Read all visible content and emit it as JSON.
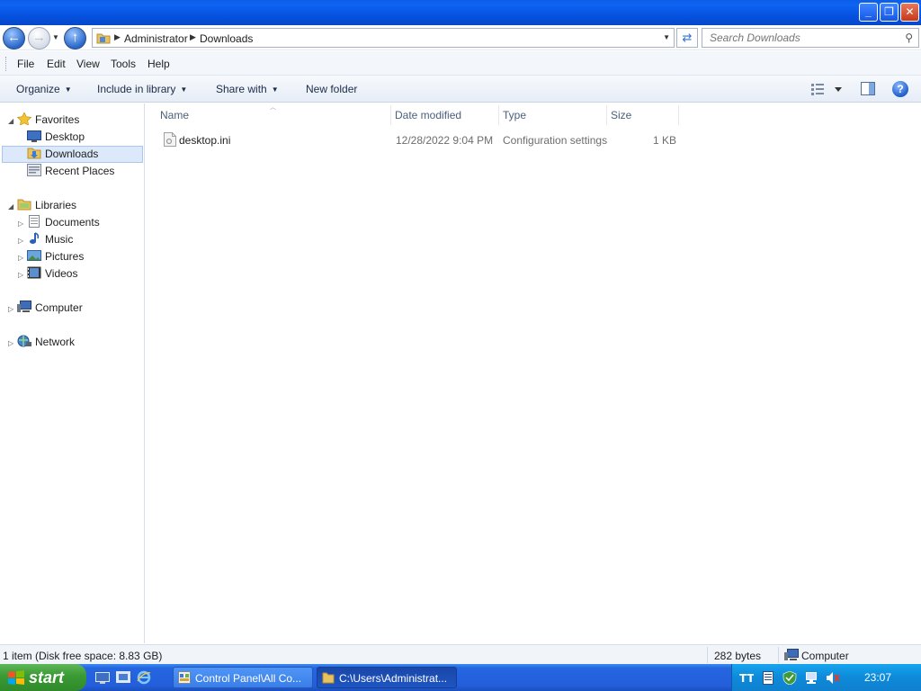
{
  "window": {
    "controls": {
      "minimize": "_",
      "restore": "❐",
      "close": "✕"
    }
  },
  "address": {
    "crumbs": [
      "Administrator",
      "Downloads"
    ],
    "search_placeholder": "Search Downloads"
  },
  "menu": {
    "items": [
      "File",
      "Edit",
      "View",
      "Tools",
      "Help"
    ]
  },
  "commands": {
    "organize": "Organize",
    "include_in_library": "Include in library",
    "share_with": "Share with",
    "new_folder": "New folder",
    "help": "?"
  },
  "nav": {
    "favorites": "Favorites",
    "desktop": "Desktop",
    "downloads": "Downloads",
    "recent_places": "Recent Places",
    "libraries": "Libraries",
    "documents": "Documents",
    "music": "Music",
    "pictures": "Pictures",
    "videos": "Videos",
    "computer": "Computer",
    "network": "Network"
  },
  "columns": {
    "name": "Name",
    "date_modified": "Date modified",
    "type": "Type",
    "size": "Size"
  },
  "files": [
    {
      "name": "desktop.ini",
      "date": "12/28/2022 9:04 PM",
      "type": "Configuration settings",
      "size": "1 KB"
    }
  ],
  "status": {
    "items": "1 item (Disk free space: 8.83 GB)",
    "bytes": "282 bytes",
    "location": "Computer"
  },
  "taskbar": {
    "start": "start",
    "tasks": [
      "Control Panel\\All Co...",
      "C:\\Users\\Administrat..."
    ],
    "clock": "23:07"
  },
  "colors": {
    "titlebar": "#0553e1",
    "taskbar": "#245edb",
    "start": "#3c9c35",
    "selection": "#dce9fa"
  }
}
